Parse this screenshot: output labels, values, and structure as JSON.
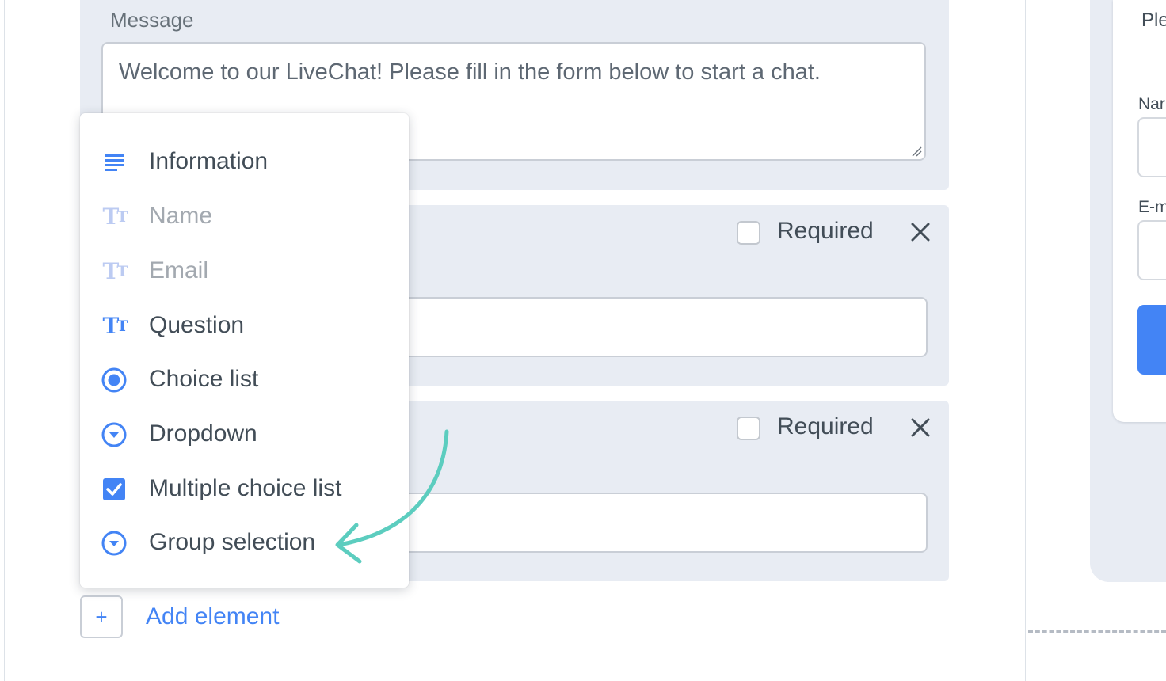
{
  "message": {
    "label": "Message",
    "text": "Welcome to our LiveChat! Please fill in the form below to start a chat."
  },
  "fields": [
    {
      "required_label": "Required",
      "required_checked": false
    },
    {
      "required_label": "Required",
      "required_checked": false
    }
  ],
  "menu": {
    "items": [
      {
        "label": "Information",
        "icon": "lines-icon",
        "disabled": false
      },
      {
        "label": "Name",
        "icon": "text-tt-icon",
        "disabled": true
      },
      {
        "label": "Email",
        "icon": "text-tt-icon",
        "disabled": true
      },
      {
        "label": "Question",
        "icon": "text-tt-icon",
        "disabled": false
      },
      {
        "label": "Choice list",
        "icon": "radio-icon",
        "disabled": false
      },
      {
        "label": "Dropdown",
        "icon": "chevron-circle-icon",
        "disabled": false
      },
      {
        "label": "Multiple choice list",
        "icon": "checkbox-icon",
        "disabled": false
      },
      {
        "label": "Group selection",
        "icon": "chevron-circle-icon",
        "disabled": false
      }
    ]
  },
  "add_element": {
    "icon_text": "+",
    "label": "Add element"
  },
  "preview": {
    "intro_fragment": "Ple",
    "name_label_fragment": "Nar",
    "email_label_fragment": "E-m"
  },
  "colors": {
    "accent": "#4384f5",
    "annotation_arrow": "#5ccdbf",
    "panel_bg": "#e8ecf3"
  }
}
